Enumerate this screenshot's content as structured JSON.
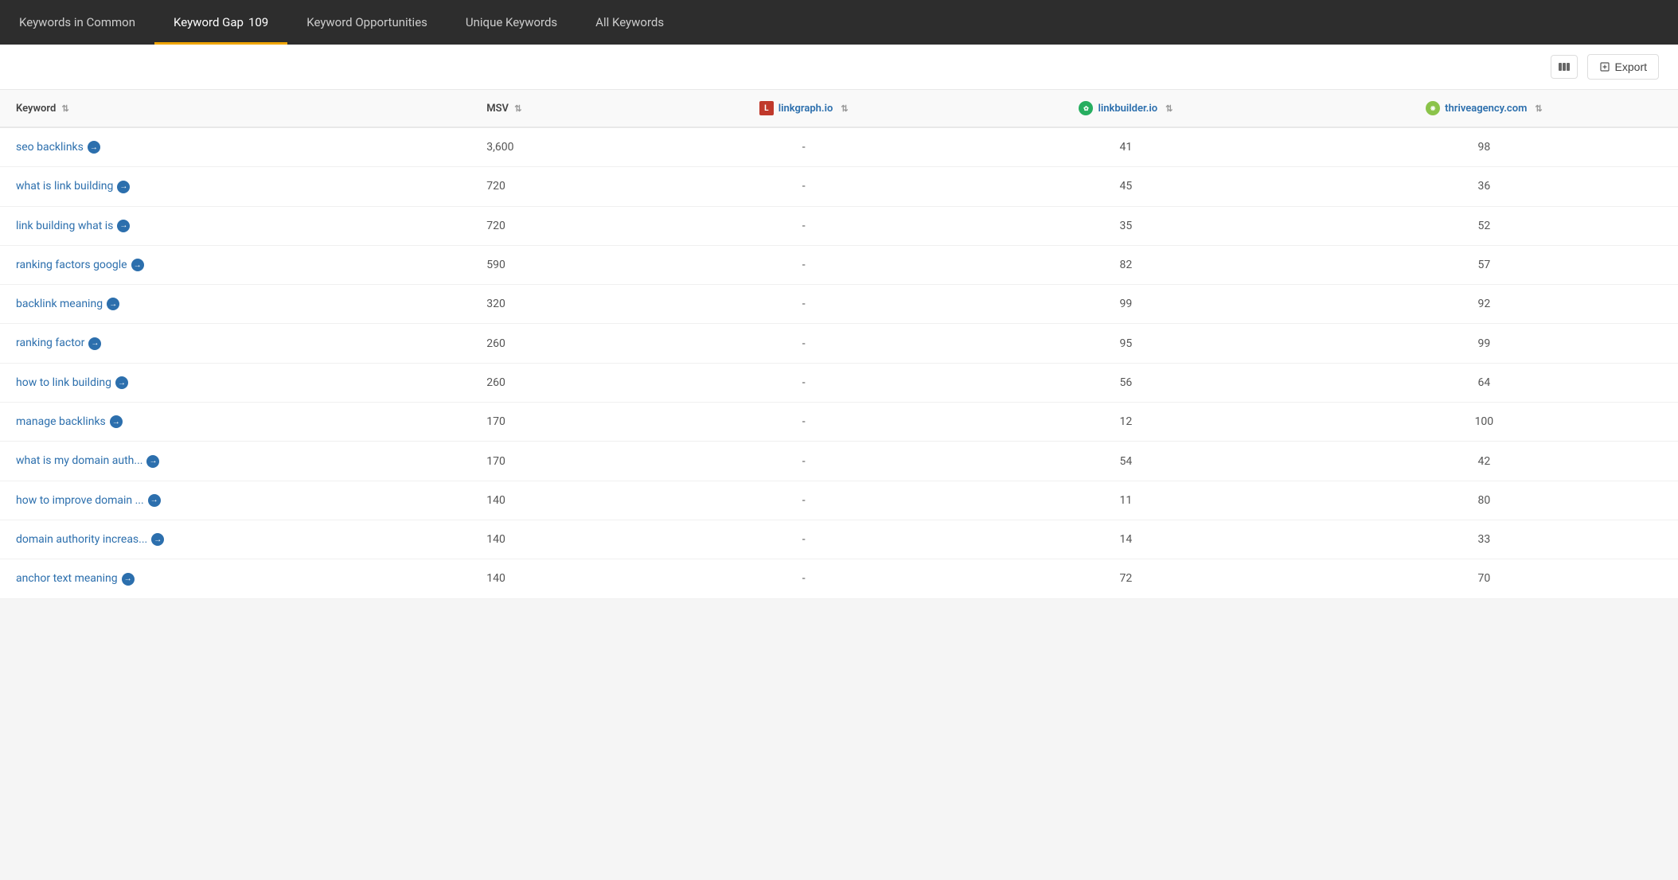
{
  "tabs": [
    {
      "id": "keywords-in-common",
      "label": "Keywords in Common",
      "badge": null,
      "active": false
    },
    {
      "id": "keyword-gap",
      "label": "Keyword Gap",
      "badge": "109",
      "active": true
    },
    {
      "id": "keyword-opportunities",
      "label": "Keyword Opportunities",
      "badge": null,
      "active": false
    },
    {
      "id": "unique-keywords",
      "label": "Unique Keywords",
      "badge": null,
      "active": false
    },
    {
      "id": "all-keywords",
      "label": "All Keywords",
      "badge": null,
      "active": false
    }
  ],
  "toolbar": {
    "export_label": "Export"
  },
  "table": {
    "columns": [
      {
        "id": "keyword",
        "label": "Keyword",
        "sortable": true
      },
      {
        "id": "msv",
        "label": "MSV",
        "sortable": true
      },
      {
        "id": "linkgraph",
        "label": "linkgraph.io",
        "sortable": true
      },
      {
        "id": "linkbuilder",
        "label": "linkbuilder.io",
        "sortable": true
      },
      {
        "id": "thriveagency",
        "label": "thriveagency.com",
        "sortable": true
      }
    ],
    "rows": [
      {
        "keyword": "seo backlinks",
        "msv": "3,600",
        "linkgraph": "-",
        "linkbuilder": "41",
        "thriveagency": "98"
      },
      {
        "keyword": "what is link building",
        "msv": "720",
        "linkgraph": "-",
        "linkbuilder": "45",
        "thriveagency": "36"
      },
      {
        "keyword": "link building what is",
        "msv": "720",
        "linkgraph": "-",
        "linkbuilder": "35",
        "thriveagency": "52"
      },
      {
        "keyword": "ranking factors google",
        "msv": "590",
        "linkgraph": "-",
        "linkbuilder": "82",
        "thriveagency": "57"
      },
      {
        "keyword": "backlink meaning",
        "msv": "320",
        "linkgraph": "-",
        "linkbuilder": "99",
        "thriveagency": "92"
      },
      {
        "keyword": "ranking factor",
        "msv": "260",
        "linkgraph": "-",
        "linkbuilder": "95",
        "thriveagency": "99"
      },
      {
        "keyword": "how to link building",
        "msv": "260",
        "linkgraph": "-",
        "linkbuilder": "56",
        "thriveagency": "64"
      },
      {
        "keyword": "manage backlinks",
        "msv": "170",
        "linkgraph": "-",
        "linkbuilder": "12",
        "thriveagency": "100"
      },
      {
        "keyword": "what is my domain auth...",
        "msv": "170",
        "linkgraph": "-",
        "linkbuilder": "54",
        "thriveagency": "42"
      },
      {
        "keyword": "how to improve domain ...",
        "msv": "140",
        "linkgraph": "-",
        "linkbuilder": "11",
        "thriveagency": "80"
      },
      {
        "keyword": "domain authority increas...",
        "msv": "140",
        "linkgraph": "-",
        "linkbuilder": "14",
        "thriveagency": "33"
      },
      {
        "keyword": "anchor text meaning",
        "msv": "140",
        "linkgraph": "-",
        "linkbuilder": "72",
        "thriveagency": "70"
      }
    ]
  }
}
